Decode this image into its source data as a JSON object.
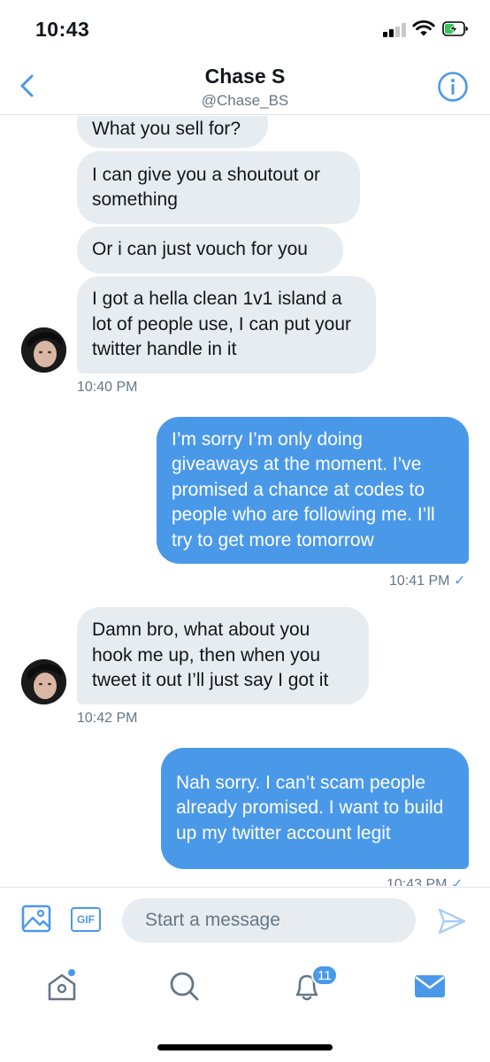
{
  "status_bar": {
    "time": "10:43"
  },
  "header": {
    "name": "Chase S",
    "handle": "@Chase_BS"
  },
  "messages": [
    {
      "id": "m1",
      "direction": "in",
      "text": "What you sell for?"
    },
    {
      "id": "m2",
      "direction": "in",
      "text": "I can give you a shoutout or something"
    },
    {
      "id": "m3",
      "direction": "in",
      "text": "Or i can just vouch for you"
    },
    {
      "id": "m4",
      "direction": "in",
      "text": "I got a hella clean 1v1 island a lot of people use, I can put your twitter handle in it"
    },
    {
      "id": "m5",
      "direction": "out",
      "text": "I’m sorry I’m only doing giveaways at the moment. I’ve promised a chance at codes to people who are following me. I’ll try to get more tomorrow"
    },
    {
      "id": "m6",
      "direction": "in",
      "text": "Damn bro, what about you hook me up, then when you tweet it out I’ll just say I got it"
    },
    {
      "id": "m7",
      "direction": "out",
      "text": "Nah sorry. I can’t scam people already promised. I want to build up my twitter account legit"
    }
  ],
  "timestamps": {
    "t1": "10:40 PM",
    "t2": "10:41 PM",
    "t3": "10:42 PM",
    "t4": "10:43 PM"
  },
  "read_check": "✓",
  "composer": {
    "gif_label": "GIF",
    "placeholder": "Start a message"
  },
  "tabbar": {
    "notifications_badge": "11"
  },
  "colors": {
    "accent": "#4a99e9",
    "incoming_bubble": "#e6ecf0",
    "muted_text": "#657786"
  },
  "icons": [
    "back-chevron-icon",
    "info-icon",
    "image-icon",
    "gif-icon",
    "send-icon",
    "home-icon",
    "search-icon",
    "bell-icon",
    "mail-icon"
  ]
}
